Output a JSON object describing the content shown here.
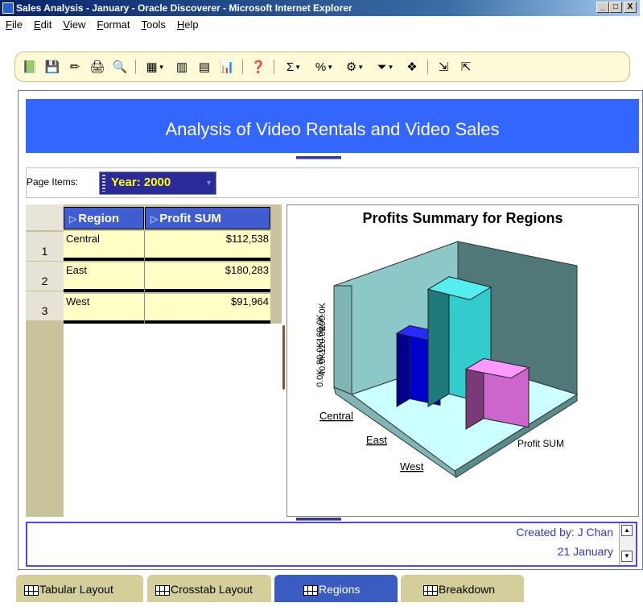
{
  "window": {
    "title": "Sales Analysis - January - Oracle Discoverer - Microsoft Internet Explorer",
    "min": "_",
    "max": "□",
    "close": "X"
  },
  "menu": [
    "File",
    "Edit",
    "View",
    "Format",
    "Tools",
    "Help"
  ],
  "toolbar_icons": [
    "open-icon",
    "save-icon",
    "new-icon",
    "print-icon",
    "print-preview-icon",
    "table-layout-icon",
    "pivot-icon",
    "crosstab-icon",
    "graph-icon",
    "help-icon",
    "totals-icon",
    "percentages-icon",
    "calculations-icon",
    "filters-icon",
    "conditions-icon",
    "export-icon",
    "import-icon"
  ],
  "banner": {
    "title": "Analysis of Video Rentals and Video Sales"
  },
  "page_items": {
    "label": "Page Items:",
    "value": "Year: 2000"
  },
  "table": {
    "headers": [
      "Region",
      "Profit SUM"
    ],
    "rows": [
      {
        "num": "1",
        "region": "Central",
        "profit": "$112,538"
      },
      {
        "num": "2",
        "region": "East",
        "profit": "$180,283"
      },
      {
        "num": "3",
        "region": "West",
        "profit": "$91,964"
      }
    ]
  },
  "chart_data": {
    "type": "bar",
    "title": "Profits Summary for Regions",
    "categories": [
      "Central",
      "East",
      "West"
    ],
    "series": [
      {
        "name": "Profit SUM",
        "values": [
          112538,
          180283,
          91964
        ]
      }
    ],
    "y_tick_labels": [
      "0.0K",
      "40.0K",
      "80.0K",
      "120.0K",
      "160.0K",
      "200.0K"
    ],
    "ylim": [
      0,
      200000
    ],
    "colors": [
      "#0000cc",
      "#33cccc",
      "#cc66cc"
    ],
    "projection": "3d"
  },
  "footer": {
    "created_by": "Created by: J Chan",
    "date": "21 January"
  },
  "tabs": [
    "Tabular Layout",
    "Crosstab Layout",
    "Regions",
    "Breakdown"
  ],
  "active_tab": "Regions"
}
